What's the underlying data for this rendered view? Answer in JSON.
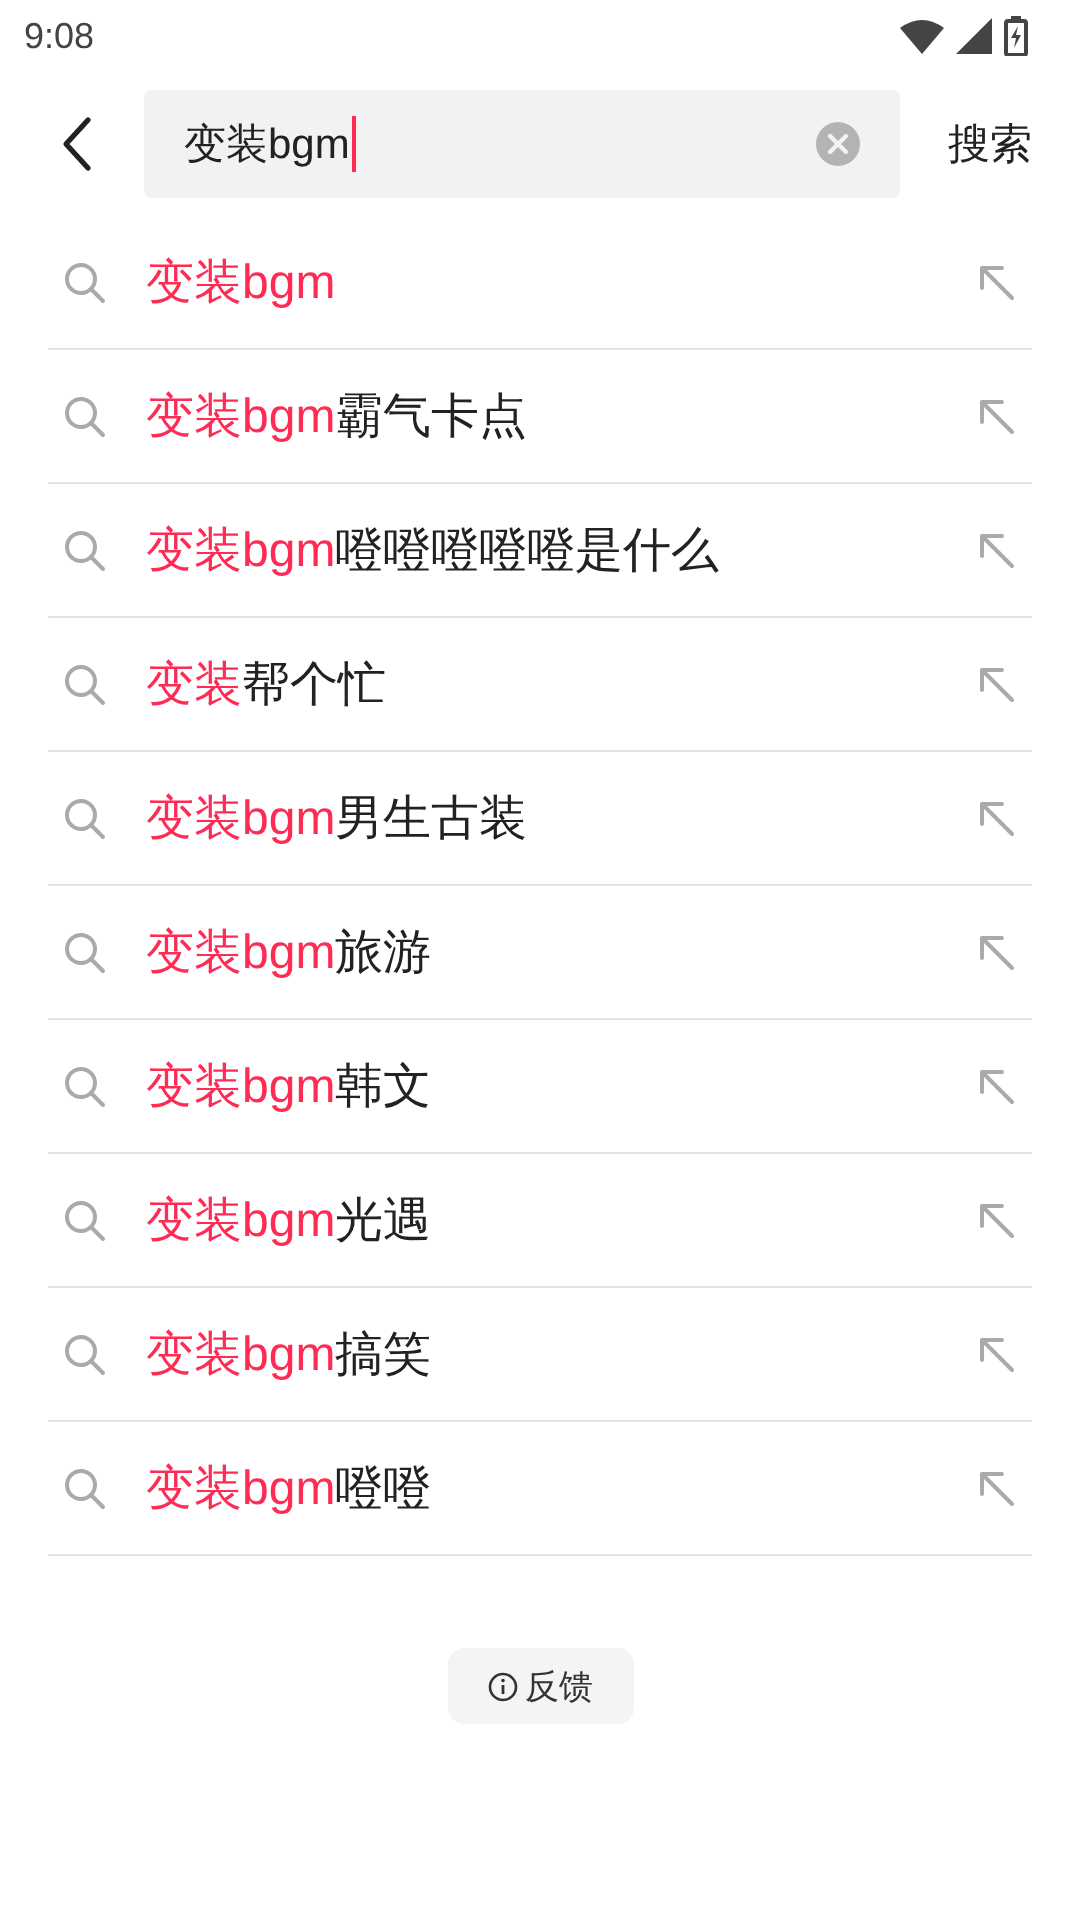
{
  "status_bar": {
    "time": "9:08"
  },
  "search": {
    "value": "变装bgm",
    "action": "搜索"
  },
  "suggestions": [
    {
      "match": "变装bgm"
    },
    {
      "match": "变装bgm",
      "rest": "霸气卡点"
    },
    {
      "match": "变装bgm",
      "rest": "噔噔噔噔噔是什么"
    },
    {
      "match": "变装",
      "rest": "帮个忙"
    },
    {
      "match": "变装bgm",
      "rest": "男生古装"
    },
    {
      "match": "变装bgm",
      "rest": "旅游"
    },
    {
      "match": "变装bgm",
      "rest": "韩文"
    },
    {
      "match": "变装bgm",
      "rest": "光遇"
    },
    {
      "match": "变装bgm",
      "rest": "搞笑"
    },
    {
      "match": "变装bgm",
      "rest": "噔噔"
    }
  ],
  "feedback": "反馈"
}
